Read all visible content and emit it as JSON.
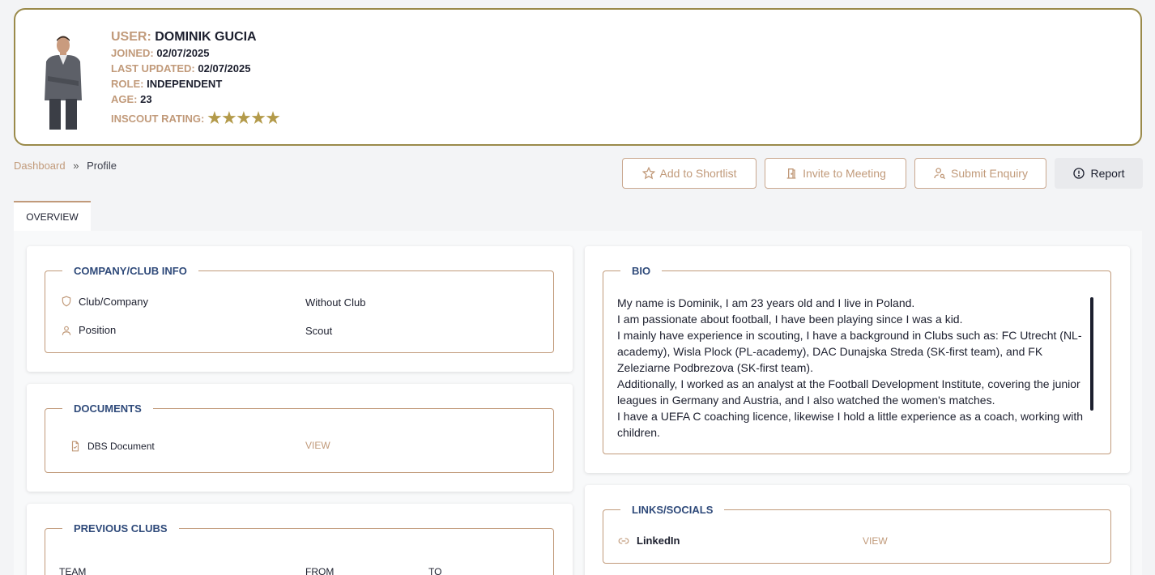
{
  "profile": {
    "user_label": "USER:",
    "user_name": "DOMINIK GUCIA",
    "joined_label": "JOINED:",
    "joined_value": "02/07/2025",
    "updated_label": "LAST UPDATED:",
    "updated_value": "02/07/2025",
    "role_label": "ROLE:",
    "role_value": "INDEPENDENT",
    "age_label": "AGE:",
    "age_value": "23",
    "rating_label": "INSCOUT RATING:",
    "rating_stars": 5
  },
  "breadcrumb": {
    "home": "Dashboard",
    "separator": "»",
    "current": "Profile"
  },
  "actions": {
    "shortlist": "Add to Shortlist",
    "meeting": "Invite to Meeting",
    "enquiry": "Submit Enquiry",
    "report": "Report"
  },
  "tabs": [
    {
      "label": "OVERVIEW"
    }
  ],
  "company": {
    "title": "COMPANY/CLUB INFO",
    "club_label": "Club/Company",
    "club_value": "Without Club",
    "position_label": "Position",
    "position_value": "Scout"
  },
  "documents": {
    "title": "DOCUMENTS",
    "items": [
      {
        "name": "DBS Document",
        "action": "VIEW"
      }
    ]
  },
  "previous_clubs": {
    "title": "PREVIOUS CLUBS",
    "columns": [
      "TEAM",
      "FROM",
      "TO"
    ]
  },
  "bio": {
    "title": "BIO",
    "paragraphs": [
      "My name is Dominik, I am 23 years old and I live in Poland.",
      "I am passionate about football, I have been playing since I was a kid.",
      "I mainly have experience in scouting, I have a background in Clubs such as: FC Utrecht (NL-academy), Wisla Plock (PL-academy), DAC Dunajska Streda (SK-first team), and FK Zeleziarne Podbrezova (SK-first team).",
      "Additionally, I worked as an analyst at the Football Development Institute, covering the junior leagues in Germany and Austria, and I also watched the women's matches.",
      "I have a UEFA C coaching licence, likewise I hold a little experience as a coach, working with children."
    ]
  },
  "links": {
    "title": "LINKS/SOCIALS",
    "items": [
      {
        "name": "LinkedIn",
        "action": "VIEW"
      }
    ]
  },
  "colors": {
    "accent": "#c19a7a",
    "navy": "#2f4a7a",
    "gold": "#b39a4a",
    "frame": "#9a8a4a"
  }
}
